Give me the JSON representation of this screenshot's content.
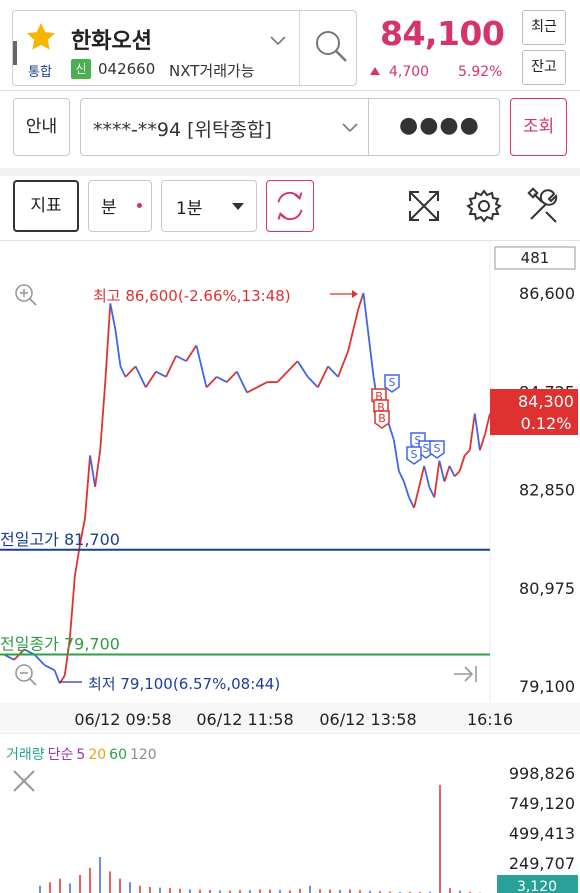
{
  "stock": {
    "name": "한화오션",
    "market": "통합",
    "nxt_badge": "신",
    "code": "042660",
    "nxt_label": "NXT거래가능",
    "price": "84,100",
    "change": "4,700",
    "change_pct": "5.92%"
  },
  "side_buttons": {
    "recent": "최근",
    "balance": "잔고"
  },
  "account": {
    "guide_label": "안내",
    "number": "****-**94 [위탁종합]",
    "password_mask": "●●●●",
    "query_label": "조회"
  },
  "toolbar": {
    "indicator_label": "지표",
    "unit_label": "분",
    "period_label": "1분"
  },
  "icons": {
    "favorite": "star-icon",
    "search": "search-icon",
    "refresh": "refresh-icon",
    "fullscreen": "expand-icon",
    "settings": "gear-icon",
    "tools": "tools-icon",
    "zoom_in": "zoom-in-icon",
    "zoom_out": "zoom-out-icon",
    "jump_latest": "jump-to-latest-icon",
    "close_volume": "close-icon"
  },
  "colors": {
    "accent": "#d6336c",
    "up": "#e03131",
    "down": "#4263eb",
    "prev_high_line": "#1c3f94",
    "prev_close_line": "#2f9e44",
    "brand_blue": "#223b8f"
  },
  "chart_data": {
    "type": "line",
    "visible_count": "481",
    "y_ticks": [
      "86,600",
      "84,725",
      "82,850",
      "80,975",
      "79,100"
    ],
    "ylim": [
      79100,
      86600
    ],
    "x_ticks": [
      "06/12 09:58",
      "06/12 11:58",
      "06/12 13:58",
      "16:16"
    ],
    "high_label": "최고 86,600(-2.66%,13:48)",
    "low_label": "최저 79,100(6.57%,08:44)",
    "prev_high": {
      "label": "전일고가 81,700",
      "value": 81700
    },
    "prev_close": {
      "label": "전일종가 79,700",
      "value": 79700
    },
    "current": {
      "price": "84,300",
      "pct": "0.12%",
      "value": 84300
    },
    "series": [
      {
        "x": [
          0,
          10,
          20,
          30,
          40,
          50,
          55,
          60,
          65,
          70,
          75,
          80,
          85,
          90,
          95,
          100,
          105,
          110,
          115,
          120,
          130,
          140,
          150,
          160,
          170,
          180,
          190,
          200,
          210,
          220,
          230,
          240,
          250,
          260,
          270,
          280,
          290,
          300,
          310,
          320,
          330,
          340,
          350,
          355,
          360,
          365,
          370,
          375,
          380,
          385,
          390,
          395,
          400,
          405,
          410,
          415,
          420,
          425,
          430,
          435,
          440,
          445,
          450,
          455,
          460,
          465,
          470,
          475,
          480
        ],
        "values": [
          79700,
          79600,
          79800,
          79700,
          79500,
          79400,
          79150,
          79300,
          80000,
          81200,
          81800,
          82300,
          83500,
          82900,
          83600,
          84900,
          86400,
          85900,
          85200,
          85000,
          85200,
          84800,
          85100,
          85000,
          85400,
          85300,
          85600,
          84800,
          85000,
          84900,
          85100,
          84700,
          84800,
          84900,
          84900,
          85100,
          85300,
          85000,
          84800,
          85200,
          85000,
          85500,
          86300,
          86600,
          85800,
          85000,
          84400,
          84200,
          84100,
          83800,
          83200,
          83000,
          82700,
          82500,
          82900,
          83300,
          82900,
          82700,
          83400,
          83000,
          83300,
          83100,
          83200,
          83500,
          83600,
          84300,
          83600,
          83900,
          84300
        ]
      }
    ],
    "trade_markers": [
      "S",
      "B",
      "B",
      "B",
      "S",
      "S",
      "S",
      "S"
    ],
    "volume": {
      "legend": [
        "거래량",
        "단순",
        "5",
        "20",
        "60",
        "120"
      ],
      "legend_colors": [
        "#2aa198",
        "#9c36b5",
        "#9c36b5",
        "#e8a317",
        "#2f9e44",
        "#868e96"
      ],
      "y_ticks": [
        "998,826",
        "749,120",
        "499,413",
        "249,707"
      ],
      "current": "3,120",
      "ylim": [
        0,
        998826
      ],
      "values": [
        60000,
        90000,
        120000,
        80000,
        150000,
        210000,
        300000,
        180000,
        120000,
        90000,
        60000,
        50000,
        45000,
        40000,
        35000,
        30000,
        28000,
        25000,
        22000,
        20000,
        26000,
        24000,
        30000,
        28000,
        26000,
        22000,
        35000,
        60000,
        32000,
        28000,
        26000,
        30000,
        24000,
        18000,
        15000,
        12000,
        8000,
        10000,
        9000,
        11000,
        900000,
        40000,
        20000,
        10000,
        3120
      ]
    }
  }
}
